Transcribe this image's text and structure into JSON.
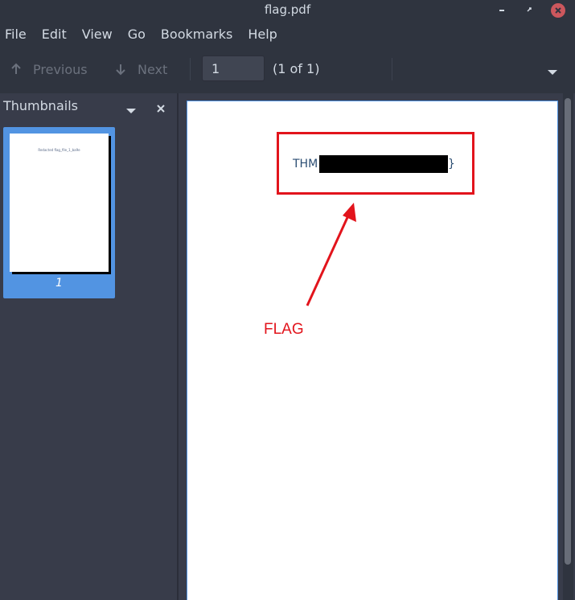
{
  "window": {
    "title": "flag.pdf"
  },
  "menu": [
    "File",
    "Edit",
    "View",
    "Go",
    "Bookmarks",
    "Help"
  ],
  "toolbar": {
    "previous_label": "Previous",
    "next_label": "Next",
    "page_value": "1",
    "page_count": "(1 of 1)"
  },
  "sidebar": {
    "title": "Thumbnails",
    "thumb_text": "Redacted flag_file_1_ba9e",
    "thumb_page_number": "1"
  },
  "document": {
    "flag_prefix": "THM{",
    "flag_suffix": "}",
    "annotation_label": "FLAG"
  },
  "colors": {
    "accent": "#5294e2",
    "annotation": "#e2141c",
    "close": "#cc575d"
  }
}
